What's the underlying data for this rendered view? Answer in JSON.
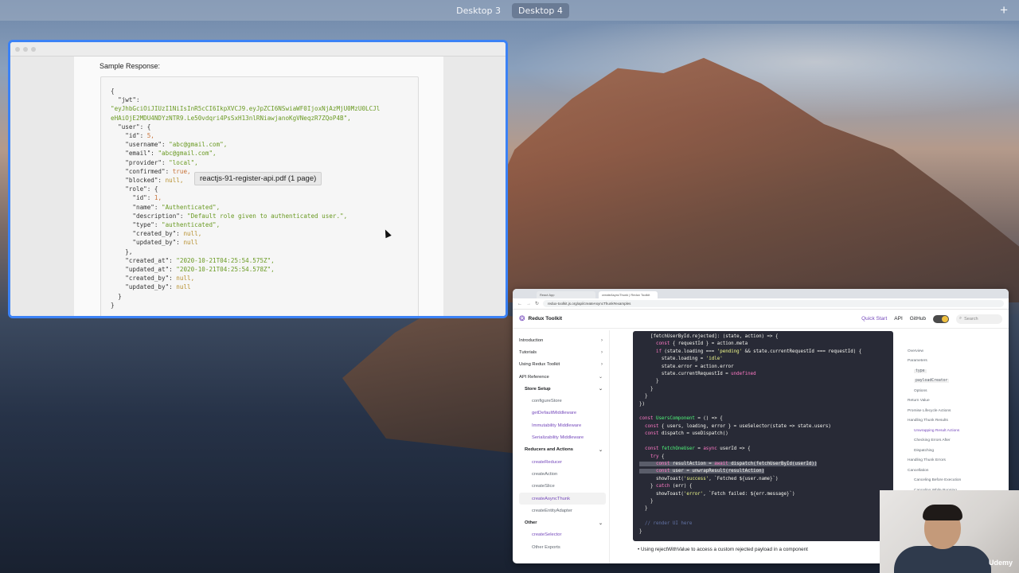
{
  "mission_control": {
    "desktops": [
      "Desktop 3",
      "Desktop 4"
    ],
    "active_desktop": "Desktop 4",
    "add_icon": "+"
  },
  "preview": {
    "section_label": "Sample Response:",
    "tooltip": "reactjs-91-register-api.pdf (1 page)",
    "json_lines": [
      "{",
      "  \"jwt\":",
      "\"eyJhbGciOiJIUzI1NiIsInR5cCI6IkpXVCJ9.eyJpZCI6NSwiaWF0IjoxNjAzMjU0MzU0LCJl",
      "eHAiOjE2MDU4NDYzNTR9.Le50vdqri4PsSxH13nlRNiawjanoKgVNeqzR7ZQoP4B\",",
      "  \"user\": {",
      "    \"id\": 5,",
      "    \"username\": \"abc@gmail.com\",",
      "    \"email\": \"abc@gmail.com\",",
      "    \"provider\": \"local\",",
      "    \"confirmed\": true,",
      "    \"blocked\": null,",
      "    \"role\": {",
      "      \"id\": 1,",
      "      \"name\": \"Authenticated\",",
      "      \"description\": \"Default role given to authenticated user.\",",
      "      \"type\": \"authenticated\",",
      "      \"created_by\": null,",
      "      \"updated_by\": null",
      "    },",
      "    \"created_at\": \"2020-10-21T04:25:54.575Z\",",
      "    \"updated_at\": \"2020-10-21T04:25:54.578Z\",",
      "    \"created_by\": null,",
      "    \"updated_by\": null",
      "  }",
      "}"
    ]
  },
  "browser": {
    "tabs": [
      "React App",
      "createAsyncThunk | Redux Toolkit"
    ],
    "url": "redux-toolkit.js.org/api/createAsyncThunk#examples",
    "site_title": "Redux Toolkit",
    "nav": {
      "quick_start": "Quick Start",
      "api": "API",
      "github": "GitHub",
      "search_placeholder": "Search"
    },
    "sidebar": [
      {
        "label": "Introduction",
        "level": 0,
        "chev": "›"
      },
      {
        "label": "Tutorials",
        "level": 0,
        "chev": "›"
      },
      {
        "label": "Using Redux Toolkit",
        "level": 0,
        "chev": "›"
      },
      {
        "label": "API Reference",
        "level": 0,
        "chev": "⌄"
      },
      {
        "label": "Store Setup",
        "level": 1,
        "chev": "⌄"
      },
      {
        "label": "configureStore",
        "level": 2,
        "plain": true
      },
      {
        "label": "getDefaultMiddleware",
        "level": 2
      },
      {
        "label": "Immutability Middleware",
        "level": 2
      },
      {
        "label": "Serializability Middleware",
        "level": 2
      },
      {
        "label": "Reducers and Actions",
        "level": 1,
        "chev": "⌄"
      },
      {
        "label": "createReducer",
        "level": 2
      },
      {
        "label": "createAction",
        "level": 2,
        "plain": true
      },
      {
        "label": "createSlice",
        "level": 2,
        "plain": true
      },
      {
        "label": "createAsyncThunk",
        "level": 2,
        "active": true
      },
      {
        "label": "createEntityAdapter",
        "level": 2,
        "plain": true
      },
      {
        "label": "Other",
        "level": 1,
        "chev": "⌄"
      },
      {
        "label": "createSelector",
        "level": 2
      },
      {
        "label": "Other Exports",
        "level": 2,
        "plain": true
      }
    ],
    "code_lines": [
      "    [fetchUserById.rejected]: (state, action) => {",
      "      const { requestId } = action.meta",
      "      if (state.loading === 'pending' && state.currentRequestId === requestId) {",
      "        state.loading = 'idle'",
      "        state.error = action.error",
      "        state.currentRequestId = undefined",
      "      }",
      "    }",
      "  }",
      "})",
      "",
      "const UsersComponent = () => {",
      "  const { users, loading, error } = useSelector(state => state.users)",
      "  const dispatch = useDispatch()",
      "",
      "  const fetchOneUser = async userId => {",
      "    try {",
      "      const resultAction = await dispatch(fetchUserById(userId))",
      "      const user = unwrapResult(resultAction)",
      "      showToast('success', `Fetched ${user.name}`)",
      "    } catch (err) {",
      "      showToast('error', `Fetch failed: ${err.message}`)",
      "    }",
      "  }",
      "",
      "  // render UI here",
      "}"
    ],
    "caption": "Using rejectWithValue to access a custom rejected payload in a component",
    "toc": [
      {
        "label": "Overview",
        "type": "item"
      },
      {
        "label": "Parameters",
        "type": "item"
      },
      {
        "label": "type",
        "type": "code"
      },
      {
        "label": "payloadCreator",
        "type": "code"
      },
      {
        "label": "Options",
        "type": "sub"
      },
      {
        "label": "Return Value",
        "type": "item"
      },
      {
        "label": "Promise Lifecycle Actions",
        "type": "item"
      },
      {
        "label": "Handling Thunk Results",
        "type": "item"
      },
      {
        "label": "Unwrapping Result Actions",
        "type": "sub",
        "active": true
      },
      {
        "label": "Checking Errors After",
        "type": "sub"
      },
      {
        "label": "Dispatching",
        "type": "sub"
      },
      {
        "label": "Handling Thunk Errors",
        "type": "item"
      },
      {
        "label": "Cancellation",
        "type": "item"
      },
      {
        "label": "Canceling Before Execution",
        "type": "sub"
      },
      {
        "label": "Canceling While Running",
        "type": "sub"
      }
    ]
  },
  "webcam": {
    "brand": "Udemy"
  }
}
